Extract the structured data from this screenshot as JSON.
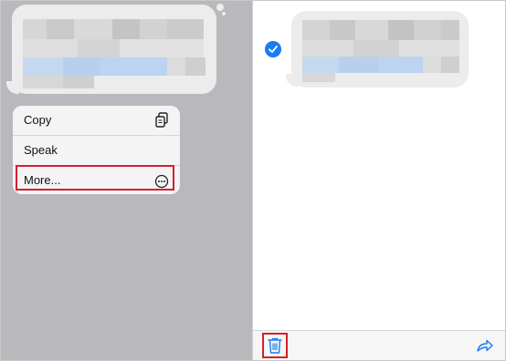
{
  "context_menu": {
    "items": [
      {
        "label": "Copy",
        "icon": "copy-icon"
      },
      {
        "label": "Speak",
        "icon": ""
      },
      {
        "label": "More...",
        "icon": "ellipsis-circle-icon"
      }
    ]
  },
  "selection": {
    "selected": true
  },
  "toolbar": {
    "delete_icon": "trash-icon",
    "forward_icon": "forward-arrow-icon"
  },
  "colors": {
    "accent": "#1a7cf5",
    "highlight_border": "#d4202a",
    "pane_gray": "#b9b9bd",
    "bubble": "#ececec"
  }
}
